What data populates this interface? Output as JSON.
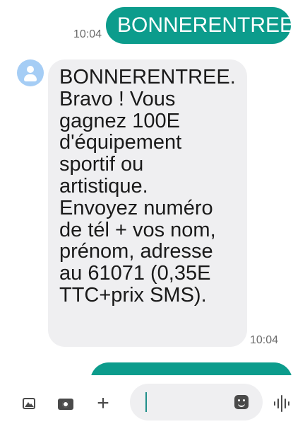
{
  "conversation": {
    "sent": {
      "text": "BONNERENTREE",
      "time": "10:04"
    },
    "received": {
      "text": "BONNERENTREE.\nBravo ! Vous\ngagnez 100E\nd'équipement\nsportif ou\nartistique.\nEnvoyez numéro\nde tél + vos nom,\nprénom, adresse\nau 61071 (0,35E\nTTC+prix SMS).",
      "time": "10:04"
    }
  },
  "composer": {
    "input_value": "",
    "icons": [
      "gallery-icon",
      "camera-icon",
      "plus-icon",
      "sticker-icon",
      "voice-wave-icon"
    ]
  },
  "colors": {
    "accent": "#0c9c8c",
    "incoming_bubble": "#efeff1",
    "avatar": "#a5cdf5",
    "timestamp": "#6b6b6b"
  }
}
